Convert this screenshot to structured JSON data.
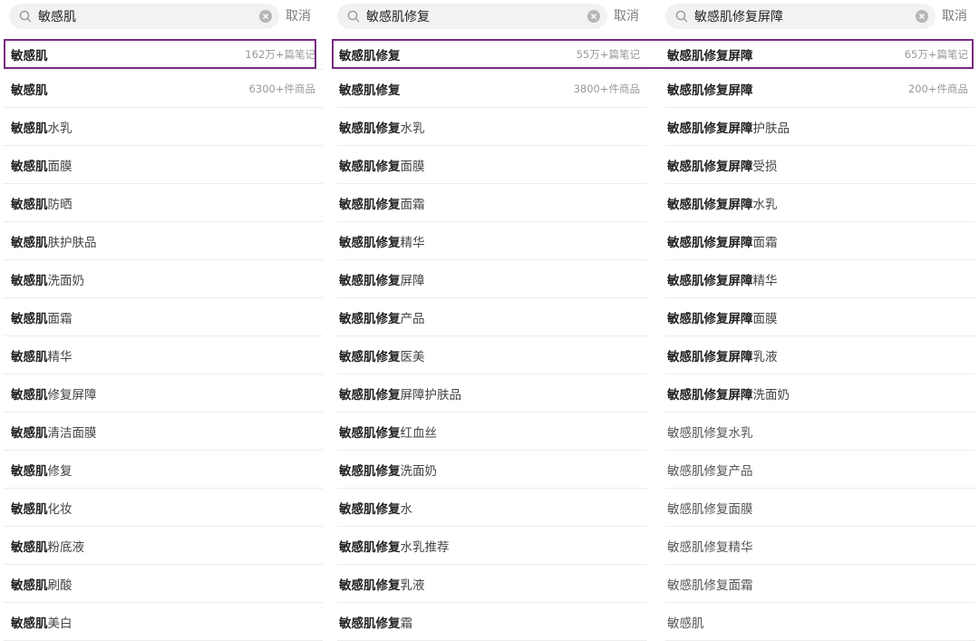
{
  "panels": [
    {
      "search_text": "敏感肌",
      "cancel": "取消",
      "rows": [
        {
          "bold": "敏感肌",
          "normal": "",
          "meta": "162万+篇笔记"
        },
        {
          "bold": "敏感肌",
          "normal": "",
          "meta": "6300+件商品"
        },
        {
          "bold": "敏感肌",
          "normal": "水乳",
          "meta": ""
        },
        {
          "bold": "敏感肌",
          "normal": "面膜",
          "meta": ""
        },
        {
          "bold": "敏感肌",
          "normal": "防晒",
          "meta": ""
        },
        {
          "bold": "敏感肌",
          "normal": "肤护肤品",
          "meta": ""
        },
        {
          "bold": "敏感肌",
          "normal": "洗面奶",
          "meta": ""
        },
        {
          "bold": "敏感肌",
          "normal": "面霜",
          "meta": ""
        },
        {
          "bold": "敏感肌",
          "normal": "精华",
          "meta": ""
        },
        {
          "bold": "敏感肌",
          "normal": "修复屏障",
          "meta": ""
        },
        {
          "bold": "敏感肌",
          "normal": "清洁面膜",
          "meta": ""
        },
        {
          "bold": "敏感肌",
          "normal": "修复",
          "meta": ""
        },
        {
          "bold": "敏感肌",
          "normal": "化妆",
          "meta": ""
        },
        {
          "bold": "敏感肌",
          "normal": "粉底液",
          "meta": ""
        },
        {
          "bold": "敏感肌",
          "normal": "刷酸",
          "meta": ""
        },
        {
          "bold": "敏感肌",
          "normal": "美白",
          "meta": ""
        }
      ]
    },
    {
      "search_text": "敏感肌修复",
      "cancel": "取消",
      "rows": [
        {
          "bold": "敏感肌修复",
          "normal": "",
          "meta": "55万+篇笔记"
        },
        {
          "bold": "敏感肌修复",
          "normal": "",
          "meta": "3800+件商品"
        },
        {
          "bold": "敏感肌修复",
          "normal": "水乳",
          "meta": ""
        },
        {
          "bold": "敏感肌修复",
          "normal": "面膜",
          "meta": ""
        },
        {
          "bold": "敏感肌修复",
          "normal": "面霜",
          "meta": ""
        },
        {
          "bold": "敏感肌修复",
          "normal": "精华",
          "meta": ""
        },
        {
          "bold": "敏感肌修复",
          "normal": "屏障",
          "meta": ""
        },
        {
          "bold": "敏感肌修复",
          "normal": "产品",
          "meta": ""
        },
        {
          "bold": "敏感肌修复",
          "normal": "医美",
          "meta": ""
        },
        {
          "bold": "敏感肌修复",
          "normal": "屏障护肤品",
          "meta": ""
        },
        {
          "bold": "敏感肌修复",
          "normal": "红血丝",
          "meta": ""
        },
        {
          "bold": "敏感肌修复",
          "normal": "洗面奶",
          "meta": ""
        },
        {
          "bold": "敏感肌修复",
          "normal": "水",
          "meta": ""
        },
        {
          "bold": "敏感肌修复",
          "normal": "水乳推荐",
          "meta": ""
        },
        {
          "bold": "敏感肌修复",
          "normal": "乳液",
          "meta": ""
        },
        {
          "bold": "敏感肌修复",
          "normal": "霜",
          "meta": ""
        }
      ]
    },
    {
      "search_text": "敏感肌修复屏障",
      "cancel": "取消",
      "rows": [
        {
          "bold": "敏感肌修复屏障",
          "normal": "",
          "meta": "65万+篇笔记"
        },
        {
          "bold": "敏感肌修复屏障",
          "normal": "",
          "meta": "200+件商品"
        },
        {
          "bold": "敏感肌修复屏障",
          "normal": "护肤品",
          "meta": ""
        },
        {
          "bold": "敏感肌修复屏障",
          "normal": "受损",
          "meta": ""
        },
        {
          "bold": "敏感肌修复屏障",
          "normal": "水乳",
          "meta": ""
        },
        {
          "bold": "敏感肌修复屏障",
          "normal": "面霜",
          "meta": ""
        },
        {
          "bold": "敏感肌修复屏障",
          "normal": "精华",
          "meta": ""
        },
        {
          "bold": "敏感肌修复屏障",
          "normal": "面膜",
          "meta": ""
        },
        {
          "bold": "敏感肌修复屏障",
          "normal": "乳液",
          "meta": ""
        },
        {
          "bold": "敏感肌修复屏障",
          "normal": "洗面奶",
          "meta": ""
        },
        {
          "bold": "",
          "normal": "敏感肌修复水乳",
          "meta": ""
        },
        {
          "bold": "",
          "normal": "敏感肌修复产品",
          "meta": ""
        },
        {
          "bold": "",
          "normal": "敏感肌修复面膜",
          "meta": ""
        },
        {
          "bold": "",
          "normal": "敏感肌修复精华",
          "meta": ""
        },
        {
          "bold": "",
          "normal": "敏感肌修复面霜",
          "meta": ""
        },
        {
          "bold": "",
          "normal": "敏感肌",
          "meta": ""
        }
      ]
    }
  ],
  "colors": {
    "highlight": "#7a2a83"
  }
}
